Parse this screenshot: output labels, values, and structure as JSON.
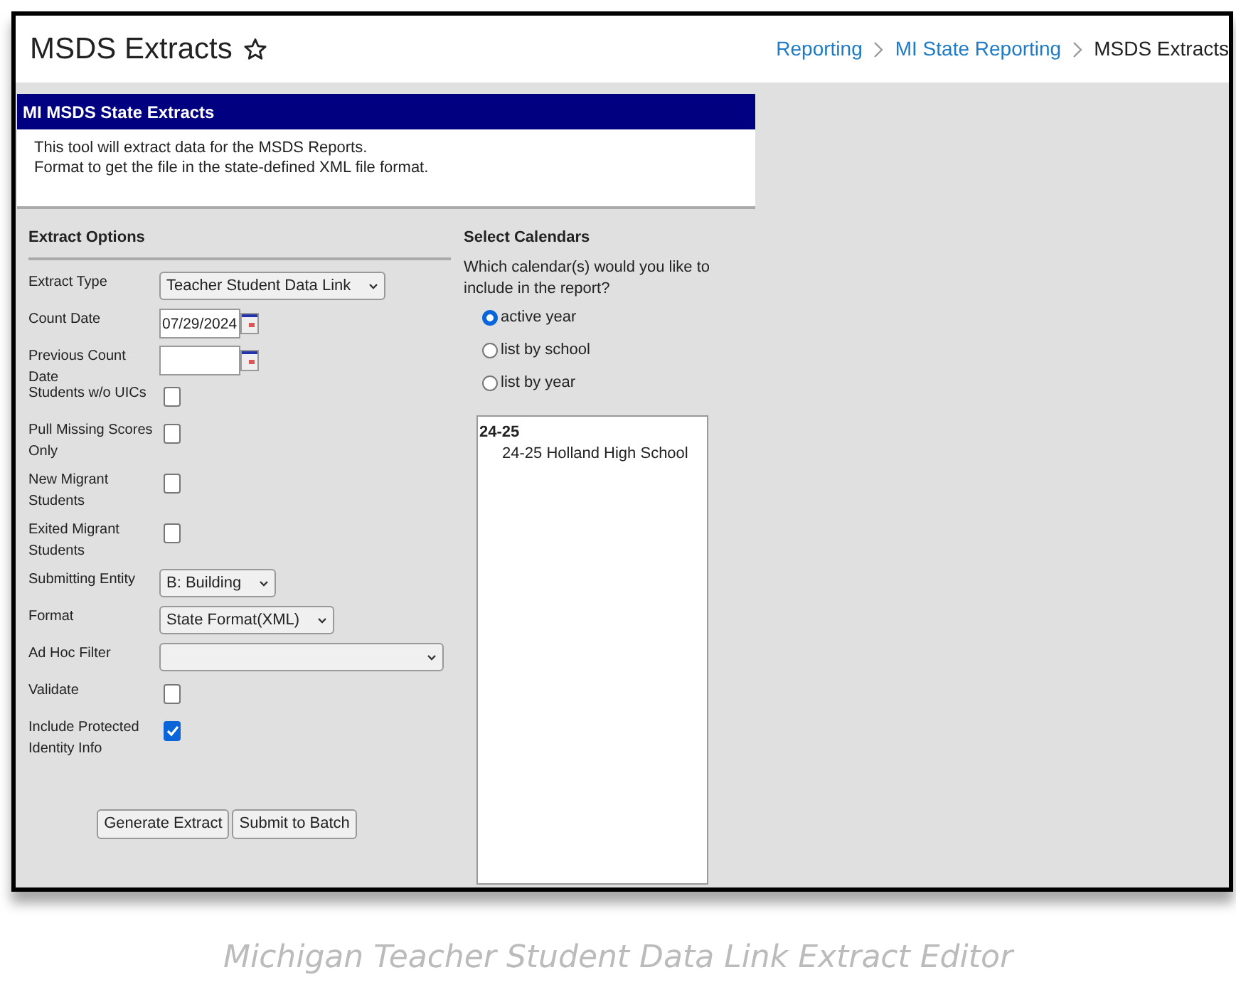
{
  "header": {
    "title": "MSDS Extracts",
    "breadcrumb": [
      {
        "label": "Reporting",
        "kind": "link"
      },
      {
        "label": "MI State Reporting",
        "kind": "link"
      },
      {
        "label": "MSDS Extracts",
        "kind": "current"
      }
    ]
  },
  "panel": {
    "title": "MI MSDS State Extracts",
    "description": [
      "This tool will extract data for the MSDS Reports.",
      "Format to get the file in the state-defined XML file format."
    ]
  },
  "extract_options": {
    "heading": "Extract Options",
    "fields": [
      {
        "label": "Extract Type",
        "kind": "select",
        "value": "Teacher Student Data Link"
      },
      {
        "label": "Count Date",
        "kind": "date",
        "value": "07/29/2024"
      },
      {
        "label": "Previous Count Date",
        "kind": "date"
      },
      {
        "label": "Students w/o UICs",
        "kind": "checkbox",
        "checked": false
      },
      {
        "label": "Pull Missing Scores Only",
        "kind": "checkbox",
        "checked": false
      },
      {
        "label": "New Migrant Students",
        "kind": "checkbox",
        "checked": false
      },
      {
        "label": "Exited Migrant Students",
        "kind": "checkbox",
        "checked": false
      },
      {
        "label": "Submitting Entity",
        "kind": "select",
        "value": "B: Building"
      },
      {
        "label": "Format",
        "kind": "select",
        "value": "State Format(XML)"
      },
      {
        "label": "Ad Hoc Filter",
        "kind": "select"
      },
      {
        "label": "Validate",
        "kind": "checkbox",
        "checked": false
      },
      {
        "label": "Include Protected Identity Info",
        "kind": "checkbox",
        "checked": true
      }
    ],
    "buttons": [
      "Generate Extract",
      "Submit to Batch"
    ]
  },
  "calendars": {
    "heading": "Select Calendars",
    "question": "Which calendar(s) would you like to include in the report?",
    "options": [
      {
        "label": "active year",
        "selected": true
      },
      {
        "label": "list by school",
        "selected": false
      },
      {
        "label": "list by year",
        "selected": false
      }
    ],
    "list": {
      "group": "24-25",
      "items": [
        "24-25 Holland High School"
      ]
    }
  },
  "caption": "Michigan Teacher Student Data Link Extract Editor"
}
